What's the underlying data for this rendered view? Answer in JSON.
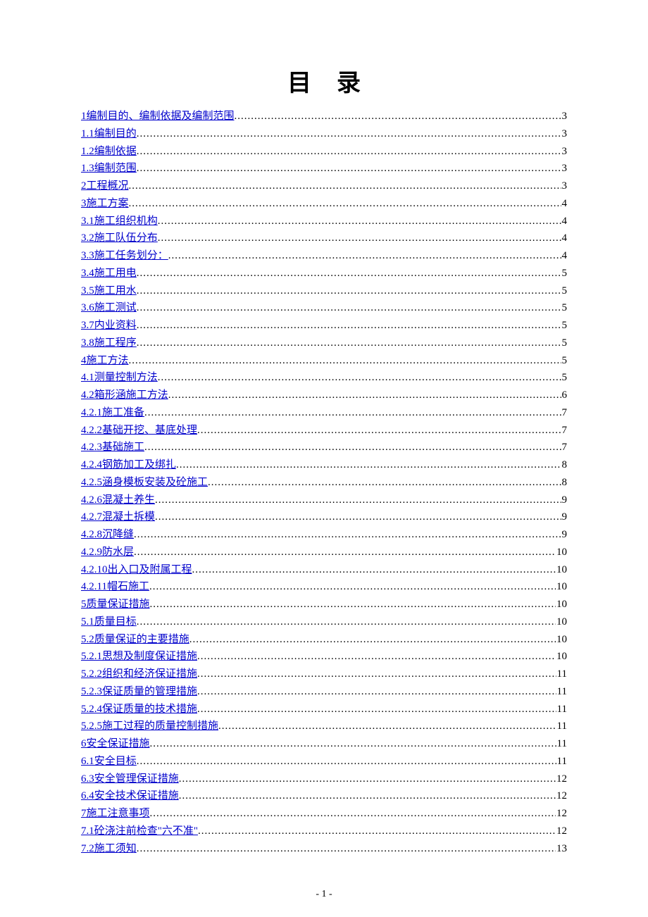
{
  "title": "目录",
  "footer": "- 1 -",
  "toc": [
    {
      "label": "1编制目的、编制依据及编制范围",
      "page": "3"
    },
    {
      "label": "1.1编制目的",
      "page": "3"
    },
    {
      "label": "1.2编制依据",
      "page": "3"
    },
    {
      "label": "1.3编制范围",
      "page": "3"
    },
    {
      "label": "2工程概况",
      "page": "3"
    },
    {
      "label": "3施工方案",
      "page": "4"
    },
    {
      "label": "3.1施工组织机构",
      "page": "4"
    },
    {
      "label": "3.2施工队伍分布",
      "page": "4"
    },
    {
      "label": "3.3施工任务划分：",
      "page": "4"
    },
    {
      "label": "3.4施工用电",
      "page": "5"
    },
    {
      "label": "3.5施工用水",
      "page": "5"
    },
    {
      "label": "3.6施工测试",
      "page": "5"
    },
    {
      "label": "3.7内业资料",
      "page": "5"
    },
    {
      "label": "3.8施工程序",
      "page": "5"
    },
    {
      "label": "4施工方法",
      "page": "5"
    },
    {
      "label": "4.1测量控制方法",
      "page": "5"
    },
    {
      "label": "4.2箱形涵施工方法",
      "page": "6"
    },
    {
      "label": "4.2.1施工准备",
      "page": "7"
    },
    {
      "label": "4.2.2基础开挖、基底处理",
      "page": "7"
    },
    {
      "label": "4.2.3基础施工",
      "page": "7"
    },
    {
      "label": "4.2.4钢筋加工及绑扎",
      "page": "8"
    },
    {
      "label": "4.2.5涵身模板安装及砼施工",
      "page": "8"
    },
    {
      "label": "4.2.6混凝土养生",
      "page": "9"
    },
    {
      "label": "4.2.7混凝土拆模",
      "page": "9"
    },
    {
      "label": "4.2.8沉降缝",
      "page": "9"
    },
    {
      "label": "4.2.9防水层",
      "page": "10"
    },
    {
      "label": "4.2.10出入口及附属工程",
      "page": "10"
    },
    {
      "label": "4.2.11帽石施工",
      "page": "10"
    },
    {
      "label": "5质量保证措施",
      "page": "10"
    },
    {
      "label": "5.1质量目标",
      "page": "10"
    },
    {
      "label": "5.2质量保证的主要措施",
      "page": "10"
    },
    {
      "label": "5.2.1思想及制度保证措施",
      "page": "10"
    },
    {
      "label": "5.2.2组织和经济保证措施",
      "page": "11"
    },
    {
      "label": "5.2.3保证质量的管理措施",
      "page": "11"
    },
    {
      "label": "5.2.4保证质量的技术措施",
      "page": "11"
    },
    {
      "label": "5.2.5施工过程的质量控制措施",
      "page": "11"
    },
    {
      "label": "6安全保证措施",
      "page": "11"
    },
    {
      "label": "6.1安全目标",
      "page": "11"
    },
    {
      "label": "6.3安全管理保证措施",
      "page": "12"
    },
    {
      "label": "6.4安全技术保证措施",
      "page": "12"
    },
    {
      "label": "7施工注意事项",
      "page": "12"
    },
    {
      "label": "7.1砼浇注前检查\"六不准\"",
      "page": "12"
    },
    {
      "label": "7.2施工须知",
      "page": "13"
    }
  ]
}
